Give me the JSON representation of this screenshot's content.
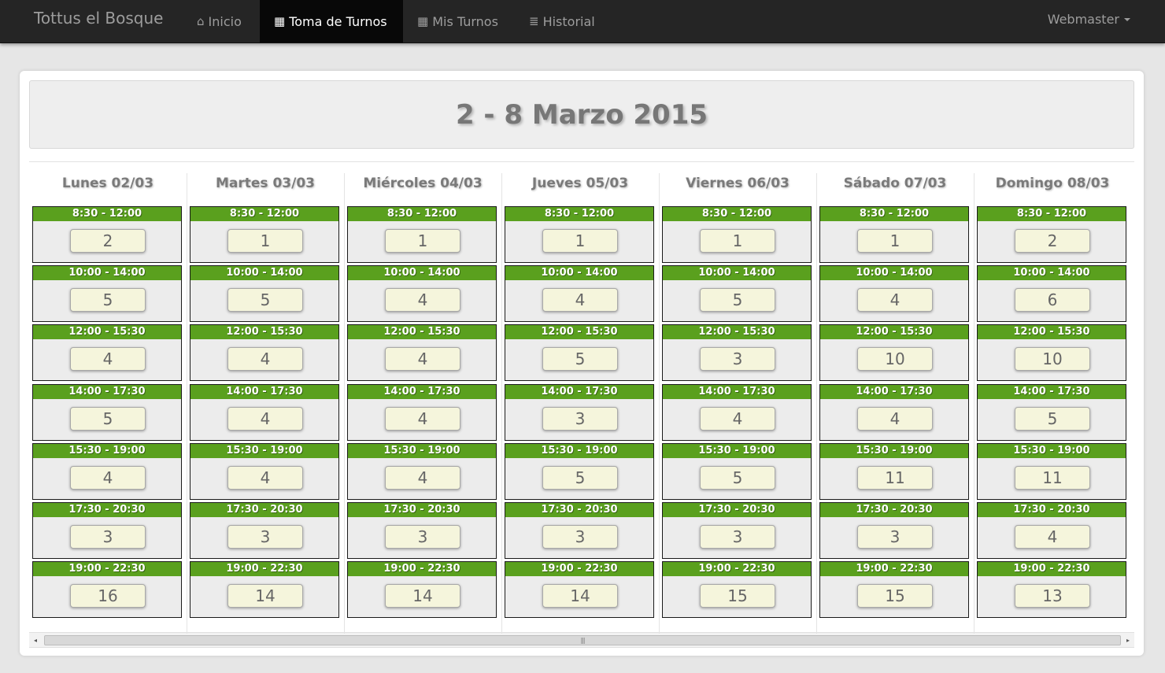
{
  "navbar": {
    "brand": "Tottus el Bosque",
    "items": [
      {
        "label": "Inicio",
        "icon": "home-icon",
        "glyph": "⌂",
        "active": false
      },
      {
        "label": "Toma de Turnos",
        "icon": "calendar-icon",
        "glyph": "▦",
        "active": true
      },
      {
        "label": "Mis Turnos",
        "icon": "grid-icon",
        "glyph": "▦",
        "active": false
      },
      {
        "label": "Historial",
        "icon": "list-icon",
        "glyph": "≣",
        "active": false
      }
    ],
    "user": "Webmaster"
  },
  "schedule": {
    "title": "2 - 8 Marzo 2015",
    "days": [
      {
        "label": "Lunes 02/03",
        "counts": [
          "2",
          "5",
          "4",
          "5",
          "4",
          "3",
          "16"
        ]
      },
      {
        "label": "Martes 03/03",
        "counts": [
          "1",
          "5",
          "4",
          "4",
          "4",
          "3",
          "14"
        ]
      },
      {
        "label": "Miércoles 04/03",
        "counts": [
          "1",
          "4",
          "4",
          "4",
          "4",
          "3",
          "14"
        ]
      },
      {
        "label": "Jueves 05/03",
        "counts": [
          "1",
          "4",
          "5",
          "3",
          "5",
          "3",
          "14"
        ]
      },
      {
        "label": "Viernes 06/03",
        "counts": [
          "1",
          "5",
          "3",
          "4",
          "5",
          "3",
          "15"
        ]
      },
      {
        "label": "Sábado 07/03",
        "counts": [
          "1",
          "4",
          "10",
          "4",
          "11",
          "3",
          "15"
        ]
      },
      {
        "label": "Domingo 08/03",
        "counts": [
          "2",
          "6",
          "10",
          "5",
          "11",
          "4",
          "13"
        ]
      }
    ],
    "slots": [
      "8:30 - 12:00",
      "10:00 - 14:00",
      "12:00 - 15:30",
      "14:00 - 17:30",
      "15:30 - 19:00",
      "17:30 - 20:30",
      "19:00 - 22:30"
    ]
  },
  "colors": {
    "navbar_bg": "#252525",
    "active_nav_bg": "#080808",
    "slot_header_green": "#5aa01e",
    "count_box_bg": "#f5f5dc"
  },
  "scrollbar": {
    "left_arrow": "◂",
    "right_arrow": "▸",
    "thumb_grip": "|||"
  }
}
